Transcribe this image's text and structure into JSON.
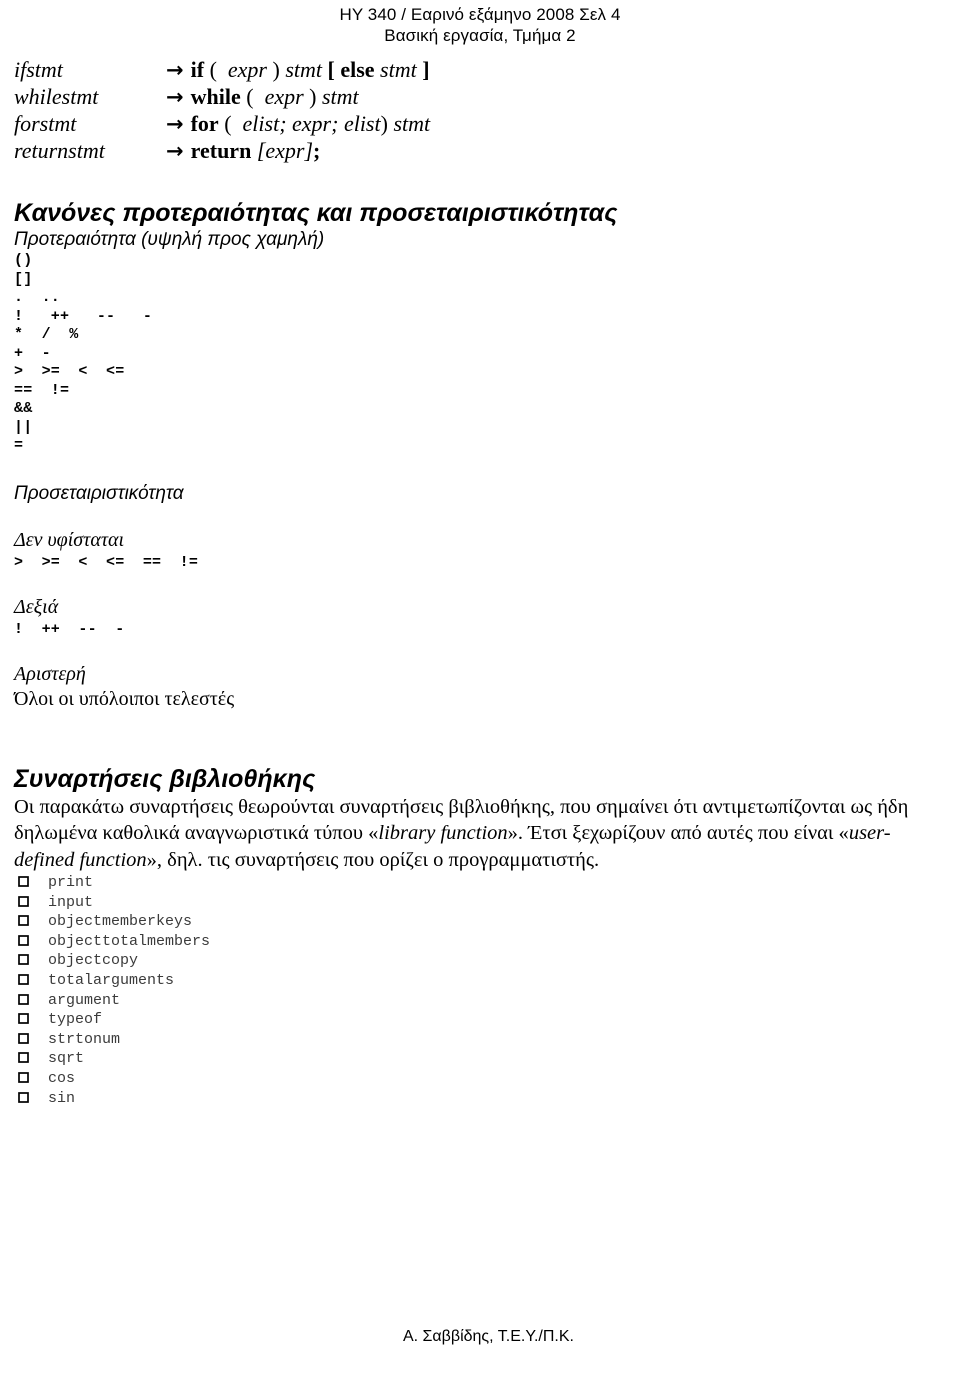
{
  "header": {
    "line1": "HY 340 / Εαρινό εξάμηνο 2008 Σελ 4",
    "line2": "Βασική εργασία, Τμήμα 2"
  },
  "grammar": {
    "arrow_glyph": "→",
    "rules": [
      {
        "lhs": "ifstmt",
        "parts": [
          {
            "text": "if",
            "style": "kw"
          },
          {
            "text": " ( ",
            "style": "pl"
          },
          {
            "text": " expr",
            "style": "it"
          },
          {
            "text": " ) ",
            "style": "pl"
          },
          {
            "text": "stmt",
            "style": "it"
          },
          {
            "text": " ",
            "style": "pl"
          },
          {
            "text": "[",
            "style": "kw"
          },
          {
            "text": " ",
            "style": "pl"
          },
          {
            "text": "else",
            "style": "kw"
          },
          {
            "text": " ",
            "style": "pl"
          },
          {
            "text": "stmt",
            "style": "it"
          },
          {
            "text": " ",
            "style": "pl"
          },
          {
            "text": "]",
            "style": "kw"
          }
        ],
        "plain": "if ( expr ) stmt [ else stmt ]"
      },
      {
        "lhs": "whilestmt",
        "parts": [
          {
            "text": "while",
            "style": "kw"
          },
          {
            "text": " ( ",
            "style": "pl"
          },
          {
            "text": " expr",
            "style": "it"
          },
          {
            "text": " ) ",
            "style": "pl"
          },
          {
            "text": "stmt",
            "style": "it"
          }
        ],
        "plain": "while ( expr ) stmt"
      },
      {
        "lhs": "forstmt",
        "parts": [
          {
            "text": "for",
            "style": "kw"
          },
          {
            "text": " ( ",
            "style": "pl"
          },
          {
            "text": " elist; expr; elist",
            "style": "it"
          },
          {
            "text": ") ",
            "style": "pl"
          },
          {
            "text": "stmt",
            "style": "it"
          }
        ],
        "plain": "for ( elist; expr; elist) stmt"
      },
      {
        "lhs": "returnstmt",
        "parts": [
          {
            "text": "return",
            "style": "kw"
          },
          {
            "text": " ",
            "style": "pl"
          },
          {
            "text": "[expr]",
            "style": "it"
          },
          {
            "text": ";",
            "style": "kw"
          }
        ],
        "plain": "return [expr];"
      }
    ]
  },
  "precedence_section": {
    "title": "Κανόνες προτεραιότητας και προσεταιριστικότητας",
    "subtitle": "Προτεραιότητα (υψηλή προς χαμηλή)",
    "levels": [
      "()",
      "[]",
      ".  ..",
      "!   ++   --   -",
      "*  /  %",
      "+  -",
      ">  >=  <  <=",
      "==  !=",
      "&&",
      "||",
      "="
    ]
  },
  "associativity_section": {
    "title": "Προσεταιριστικότητα",
    "groups": [
      {
        "label": "Δεν υφίσταται",
        "operators": ">  >=  <  <=  ==  !=",
        "note": ""
      },
      {
        "label": "Δεξιά",
        "operators": "!  ++  --  -",
        "note": ""
      },
      {
        "label": "Αριστερή",
        "operators": "",
        "note": "Όλοι οι υπόλοιποι τελεστές"
      }
    ]
  },
  "library_section": {
    "title": "Συναρτήσεις βιβλιοθήκης",
    "paragraph": {
      "part1": "Οι παρακάτω συναρτήσεις θεωρούνται συναρτήσεις βιβλιοθήκης, που σημαίνει  ότι αντιμετωπίζονται ως ήδη δηλωμένα καθολικά αναγνωριστικά τύπου «",
      "emph1": "library function",
      "part2": "». Έτσι ξεχωρίζουν από αυτές που είναι  «",
      "emph2": "user-defined function",
      "part3": "», δηλ. τις συναρτήσεις που ορίζει ο προγραμματιστής."
    },
    "bullet_glyph": "checkbox-square-bullet",
    "functions": [
      "print",
      "input",
      "objectmemberkeys",
      "objecttotalmembers",
      "objectcopy",
      "totalarguments",
      "argument",
      "typeof",
      "strtonum",
      "sqrt",
      "cos",
      "sin"
    ]
  },
  "footer": {
    "text": "Α. Σαββίδης, Τ.Ε.Υ./Π.Κ."
  },
  "colors": {
    "text": "#000000",
    "code_text": "#3b3b3b",
    "background": "#ffffff"
  }
}
